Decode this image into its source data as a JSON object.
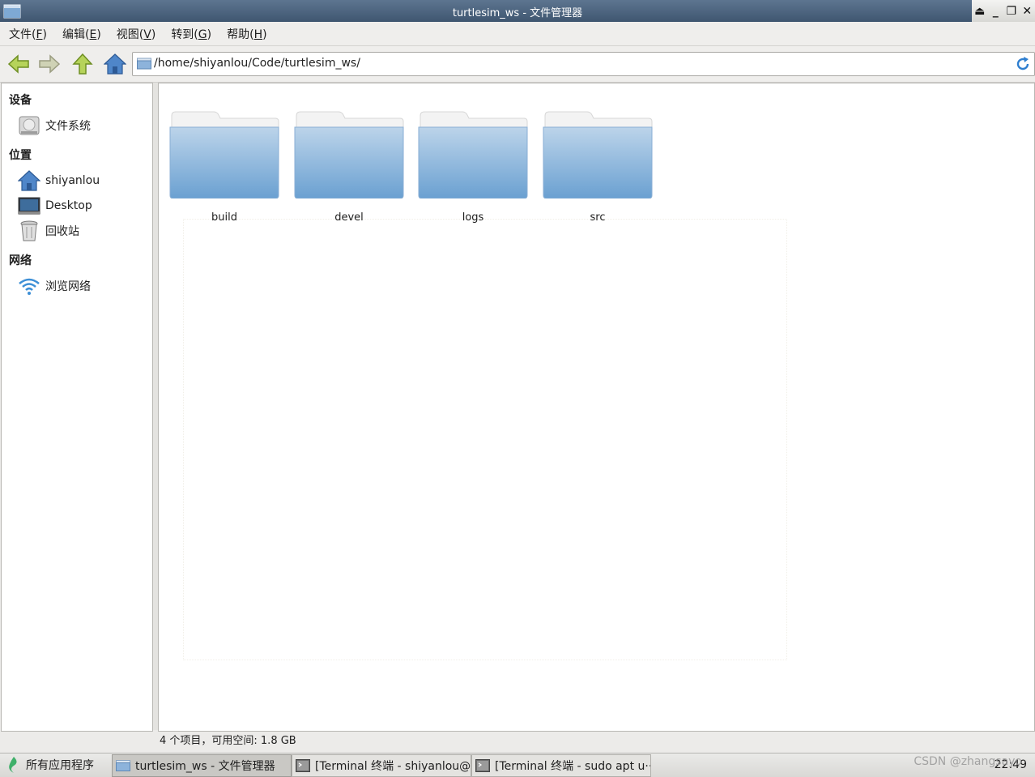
{
  "window": {
    "title": "turtlesim_ws - 文件管理器",
    "controls": [
      "⏏",
      "_",
      "❐",
      "✕"
    ]
  },
  "menubar": [
    {
      "label": "文件(",
      "key": "F",
      "end": ")"
    },
    {
      "label": "编辑(",
      "key": "E",
      "end": ")"
    },
    {
      "label": "视图(",
      "key": "V",
      "end": ")"
    },
    {
      "label": "转到(",
      "key": "G",
      "end": ")"
    },
    {
      "label": "帮助(",
      "key": "H",
      "end": ")"
    }
  ],
  "toolbar": {
    "address": "/home/shiyanlou/Code/turtlesim_ws/",
    "icons": [
      "back-arrow-icon",
      "forward-arrow-icon",
      "up-arrow-icon",
      "home-icon",
      "folder-icon",
      "reload-icon"
    ]
  },
  "sidebar": {
    "devices_heading": "设备",
    "devices": [
      {
        "label": "文件系统",
        "icon": "drive-icon"
      }
    ],
    "places_heading": "位置",
    "places": [
      {
        "label": "shiyanlou",
        "icon": "home-icon"
      },
      {
        "label": "Desktop",
        "icon": "desktop-icon"
      },
      {
        "label": "回收站",
        "icon": "trash-icon"
      }
    ],
    "network_heading": "网络",
    "network": [
      {
        "label": "浏览网络",
        "icon": "wifi-icon"
      }
    ]
  },
  "content": {
    "folders": [
      "build",
      "devel",
      "logs",
      "src"
    ]
  },
  "statusbar": {
    "text": "4 个项目，可用空间: 1.8 GB"
  },
  "taskbar": {
    "menu": "所有应用程序",
    "tasks": [
      "turtlesim_ws - 文件管理器",
      "[Terminal 终端 - shiyanlou@···",
      "[Terminal 终端 - sudo apt u···"
    ],
    "clock": "22:49"
  },
  "watermark": "CSDN @zhangsayo",
  "colors": {
    "titlebar": "#4f6780",
    "folder_top": "#bcd4ea",
    "folder_bottom": "#6aa0d1"
  }
}
